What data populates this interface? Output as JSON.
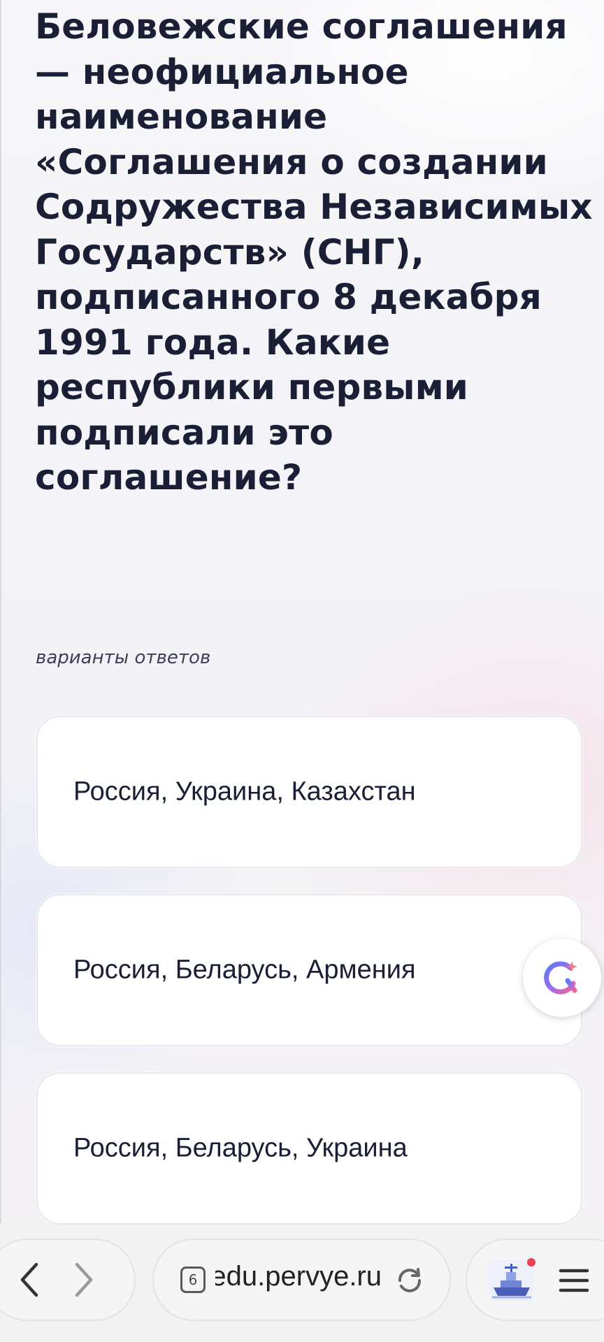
{
  "question": {
    "text": "Беловежские соглашения — неофициальное наименование «Соглашения о создании Содружества Независимых Государств» (СНГ), подписанного 8 декабря 1991 года. Какие республики первыми подписали это соглашение?"
  },
  "answers": {
    "caption": "варианты ответов",
    "options": [
      {
        "label": "Россия, Украина, Казахстан"
      },
      {
        "label": "Россия, Беларусь, Армения"
      },
      {
        "label": "Россия, Беларусь, Украина"
      }
    ]
  },
  "assistant_button": {
    "icon": "assistant-icon"
  },
  "browser": {
    "tab_count": "6",
    "url": "edu.pervye.ru",
    "back_icon": "chevron-left-icon",
    "forward_icon": "chevron-right-icon",
    "reload_icon": "reload-icon",
    "extension_icon": "ship-icon",
    "menu_icon": "menu-icon",
    "notification_color": "#ee4055"
  },
  "colors": {
    "text_primary": "#1a1f36",
    "card_background": "#ffffff",
    "card_border": "#e6e6ee"
  }
}
